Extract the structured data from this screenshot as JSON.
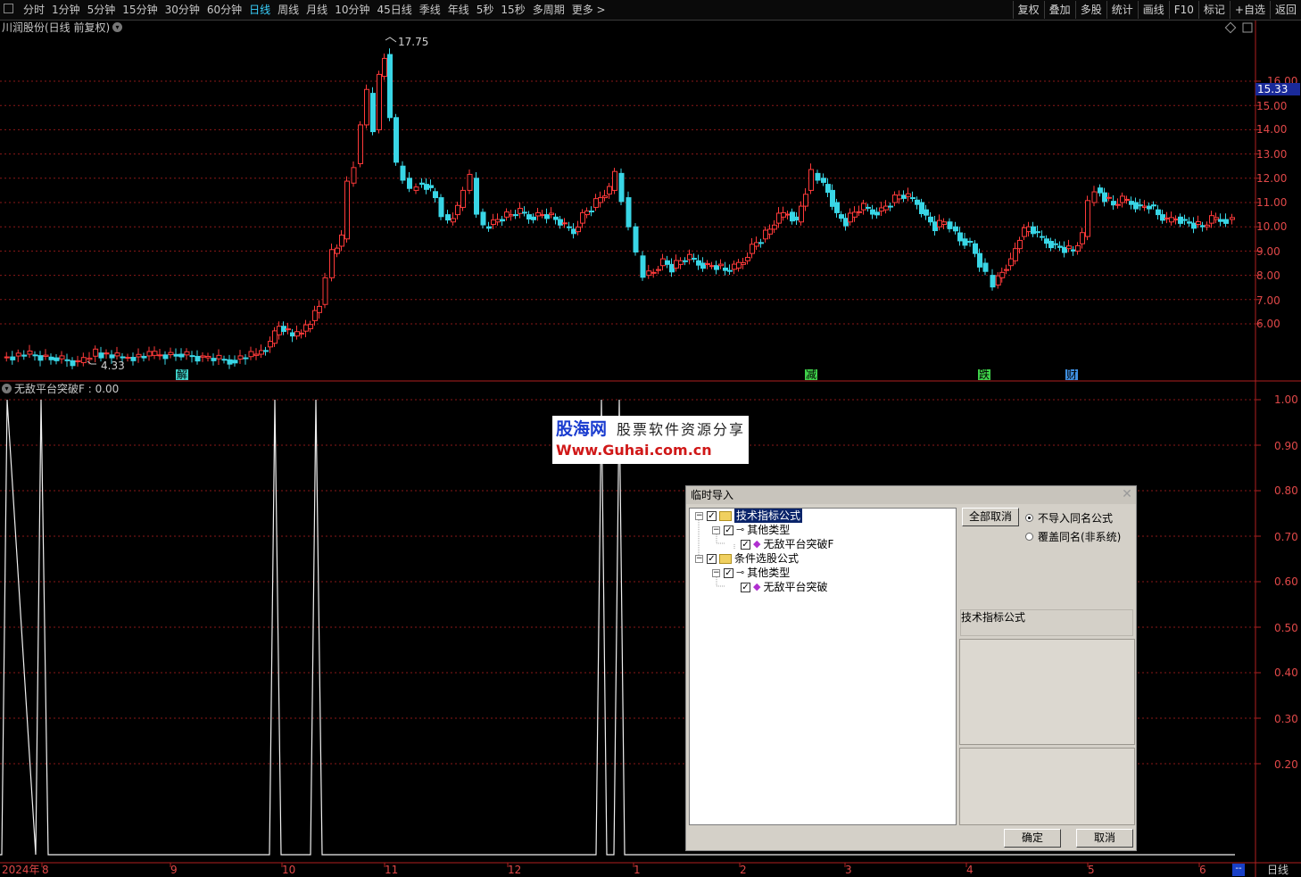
{
  "toolbar": {
    "periods": [
      "分时",
      "1分钟",
      "5分钟",
      "15分钟",
      "30分钟",
      "60分钟",
      "日线",
      "周线",
      "月线",
      "10分钟",
      "45日线",
      "季线",
      "年线",
      "5秒",
      "15秒",
      "多周期",
      "更多 >"
    ],
    "active_period": "日线",
    "tools": [
      "复权",
      "叠加",
      "多股",
      "统计",
      "画线",
      "F10",
      "标记",
      "+自选",
      "返回"
    ]
  },
  "chart": {
    "title": "川润股份(日线 前复权)",
    "price_ticks": [
      "16.00",
      "15.00",
      "14.00",
      "13.00",
      "12.00",
      "11.00",
      "10.00",
      "9.00",
      "8.00",
      "7.00",
      "6.00"
    ],
    "current_price": "15.33",
    "high_label": "17.75",
    "low_label": "4.33",
    "event_marks": [
      {
        "label": "解",
        "color": "#3fd0c8"
      },
      {
        "label": "减",
        "color": "#3fd04a"
      },
      {
        "label": "跌",
        "color": "#3fd04a"
      },
      {
        "label": "财",
        "color": "#3f8fe0"
      }
    ]
  },
  "indicator": {
    "title": "无敌平台突破F : 0.00",
    "ticks": [
      "1.00",
      "0.90",
      "0.80",
      "0.70",
      "0.60",
      "0.50",
      "0.40",
      "0.30",
      "0.20"
    ]
  },
  "xaxis": {
    "labels": [
      "2024年",
      "8",
      "9",
      "10",
      "11",
      "12",
      "1",
      "2",
      "3",
      "4",
      "5",
      "6"
    ],
    "period": "日线",
    "dash": "--"
  },
  "watermark": {
    "brand": "股海网",
    "tagline": "股票软件资源分享",
    "url": "Www.Guhai.com.cn"
  },
  "dialog": {
    "title": "临时导入",
    "tree": [
      {
        "label": "技术指标公式",
        "level": 0,
        "selected": true
      },
      {
        "label": "其他类型",
        "level": 1
      },
      {
        "label": "无敌平台突破F",
        "level": 2
      },
      {
        "label": "条件选股公式",
        "level": 0
      },
      {
        "label": "其他类型",
        "level": 1
      },
      {
        "label": "无敌平台突破",
        "level": 2
      }
    ],
    "cancel_all": "全部取消",
    "radio_no_import": "不导入同名公式",
    "radio_overwrite": "覆盖同名(非系统)",
    "info_label": "技术指标公式",
    "ok": "确定",
    "cancel": "取消"
  }
}
